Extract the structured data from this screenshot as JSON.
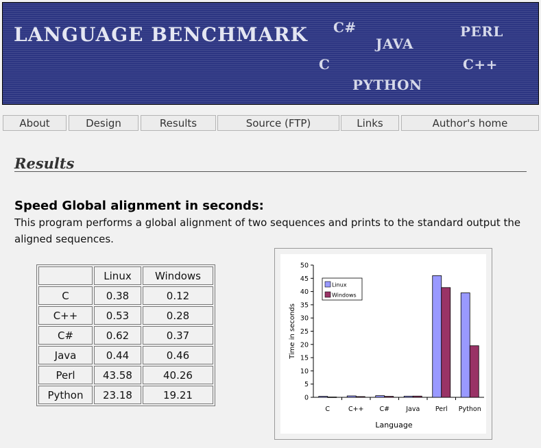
{
  "banner": {
    "title": "LANGUAGE BENCHMARK",
    "languages": [
      "C#",
      "JAVA",
      "PERL",
      "C",
      "C++",
      "PYTHON"
    ]
  },
  "nav": {
    "items": [
      "About",
      "Design",
      "Results",
      "Source (FTP)",
      "Links",
      "Author's home"
    ]
  },
  "page": {
    "section_title": "Results",
    "subtitle": "Speed Global alignment in seconds:",
    "description": "This program performs a global alignment of two sequences and prints to the standard output the aligned sequences."
  },
  "table": {
    "headers": [
      "",
      "Linux",
      "Windows"
    ],
    "rows": [
      [
        "C",
        "0.38",
        "0.12"
      ],
      [
        "C++",
        "0.53",
        "0.28"
      ],
      [
        "C#",
        "0.62",
        "0.37"
      ],
      [
        "Java",
        "0.44",
        "0.46"
      ],
      [
        "Perl",
        "43.58",
        "40.26"
      ],
      [
        "Python",
        "23.18",
        "19.21"
      ]
    ]
  },
  "colors": {
    "banner": "#2c3582",
    "linux": "#9999ff",
    "windows": "#993366"
  },
  "chart_data": {
    "type": "bar",
    "categories": [
      "C",
      "C++",
      "C#",
      "Java",
      "Perl",
      "Python"
    ],
    "series": [
      {
        "name": "Linux",
        "values": [
          0.38,
          0.53,
          0.62,
          0.44,
          46.0,
          39.5
        ],
        "color": "#9999ff"
      },
      {
        "name": "Windows",
        "values": [
          0.12,
          0.28,
          0.37,
          0.46,
          41.5,
          19.5
        ],
        "color": "#993366"
      }
    ],
    "xlabel": "Language",
    "ylabel": "Time in seconds",
    "ylim": [
      0,
      50
    ],
    "yticks": [
      0,
      5,
      10,
      15,
      20,
      25,
      30,
      35,
      40,
      45,
      50
    ],
    "legend": "top-left",
    "grid": false
  }
}
